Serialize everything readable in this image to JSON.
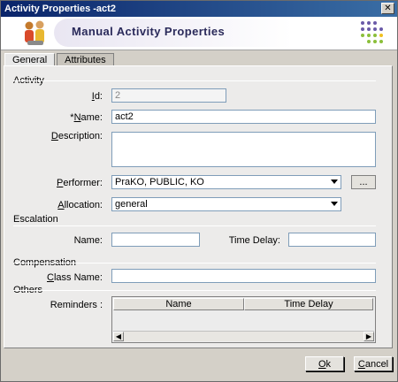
{
  "window": {
    "title": "Activity Properties -act2",
    "close_glyph": "✕"
  },
  "banner": {
    "title": "Manual Activity Properties",
    "icon": "people-icon",
    "logo": "dots-logo"
  },
  "tabs": [
    {
      "label": "General",
      "active": true
    },
    {
      "label": "Attributes",
      "active": false
    }
  ],
  "activity": {
    "section": "Activity",
    "id_label": "Id:",
    "id_value": "2",
    "name_label": "*Name:",
    "name_value": "act2",
    "description_label": "Description:",
    "description_value": "",
    "performer_label": "Performer:",
    "performer_value": "PraKO, PUBLIC, KO",
    "performer_button": "...",
    "allocation_label": "Allocation:",
    "allocation_value": "general"
  },
  "escalation": {
    "section": "Escalation",
    "name_label": "Name:",
    "name_value": "",
    "time_delay_label": "Time Delay:",
    "time_delay_value": ""
  },
  "compensation": {
    "section": "Compensation",
    "class_name_label": "Class Name:",
    "class_name_value": ""
  },
  "others": {
    "section": "Others",
    "reminders_label": "Reminders :",
    "columns": [
      "Name",
      "Time Delay"
    ],
    "rows": []
  },
  "footer": {
    "ok_label": "Ok",
    "cancel_label": "Cancel"
  },
  "colors": {
    "title_bar": "#0a246a",
    "banner_text": "#2a2a5a",
    "panel": "#ecebea"
  }
}
